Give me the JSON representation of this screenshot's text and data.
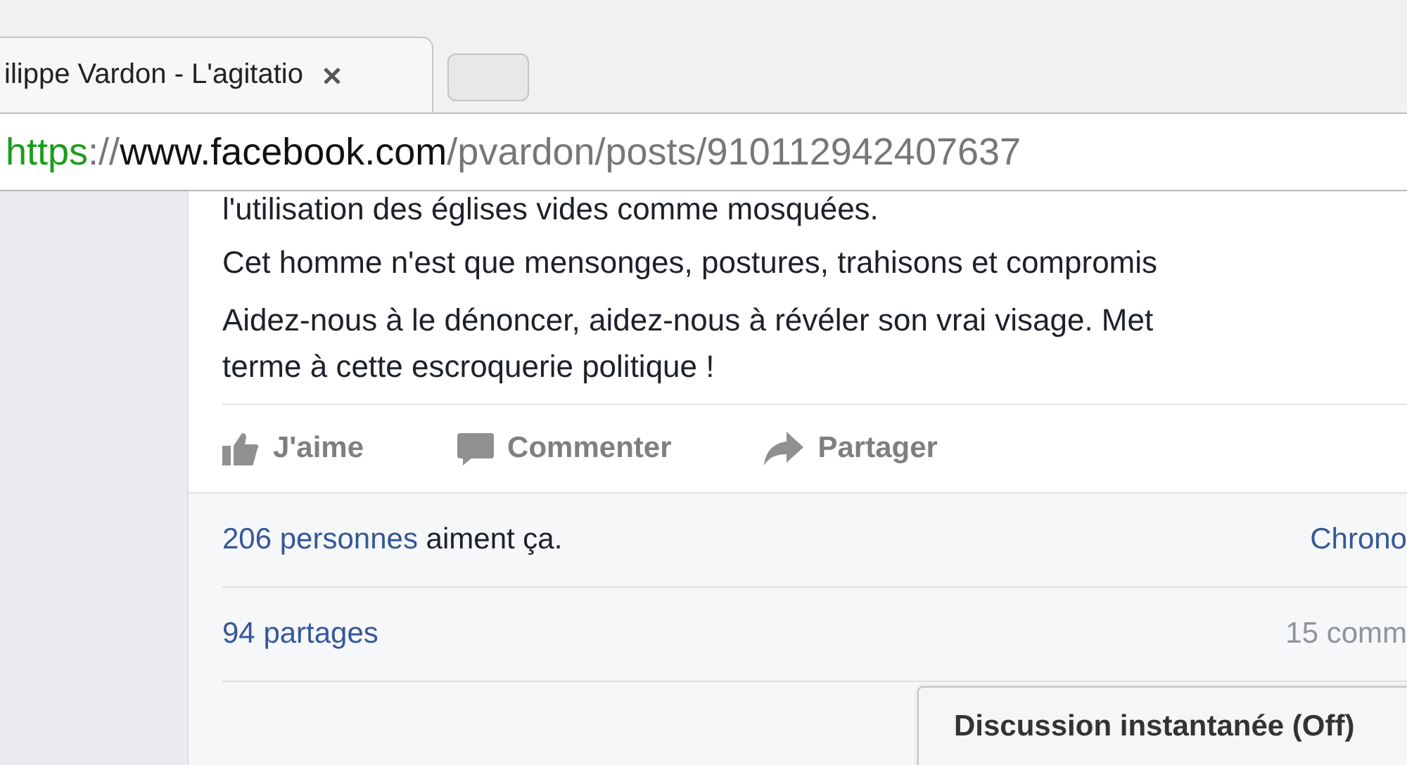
{
  "browser": {
    "tab": {
      "title": "ilippe Vardon - L'agitatio",
      "selected": true
    },
    "address": {
      "scheme": "https",
      "separator": "://",
      "host": "www.facebook.com",
      "path": "/pvardon/posts/910112942407637"
    }
  },
  "post": {
    "paragraphs": [
      "l'utilisation des églises vides comme mosquées.",
      "Cet homme n'est que mensonges, postures, trahisons et compromis",
      "Aidez-nous à le dénoncer, aidez-nous à révéler son vrai visage. Met\nterme à cette escroquerie politique !"
    ],
    "actions": [
      {
        "kind": "like",
        "label": "J'aime"
      },
      {
        "kind": "comment",
        "label": "Commenter"
      },
      {
        "kind": "share",
        "label": "Partager"
      }
    ],
    "likes": {
      "link": "206 personnes",
      "text": "aiment ça.",
      "order": "Chrono"
    },
    "shares": {
      "link": "94 partages",
      "comments": "15 comm"
    }
  },
  "chat": {
    "title": "Discussion instantanée (Off)"
  }
}
